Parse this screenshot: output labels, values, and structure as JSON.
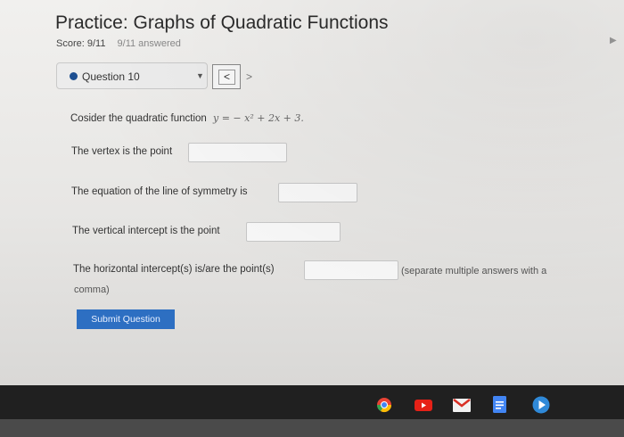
{
  "page": {
    "title": "Practice: Graphs of Quadratic Functions",
    "score": "Score: 9/11",
    "answered": "9/11 answered"
  },
  "question_nav": {
    "current": "Question 10",
    "prev_label": "<",
    "next_label": ">"
  },
  "question": {
    "prompt": "Cosider the quadratic function",
    "equation": "y = − x² + 2x + 3.",
    "vertex_label": "The vertex is the point",
    "symmetry_label": "The equation of the line of symmetry is",
    "vertical_label": "The vertical intercept is the point",
    "horizontal_label": "The horizontal intercept(s) is/are the point(s)",
    "horizontal_note_1": "(separate multiple answers with a",
    "horizontal_note_2": "comma)"
  },
  "inputs": {
    "vertex_value": "",
    "symmetry_value": "",
    "vertical_value": "",
    "horizontal_value": ""
  },
  "buttons": {
    "submit": "Submit Question"
  },
  "taskbar": {
    "icons": [
      "chrome-icon",
      "youtube-icon",
      "gmail-icon",
      "docs-icon",
      "play-icon"
    ]
  },
  "colors": {
    "accent": "#2d6fc2",
    "dot": "#1d4f91"
  }
}
